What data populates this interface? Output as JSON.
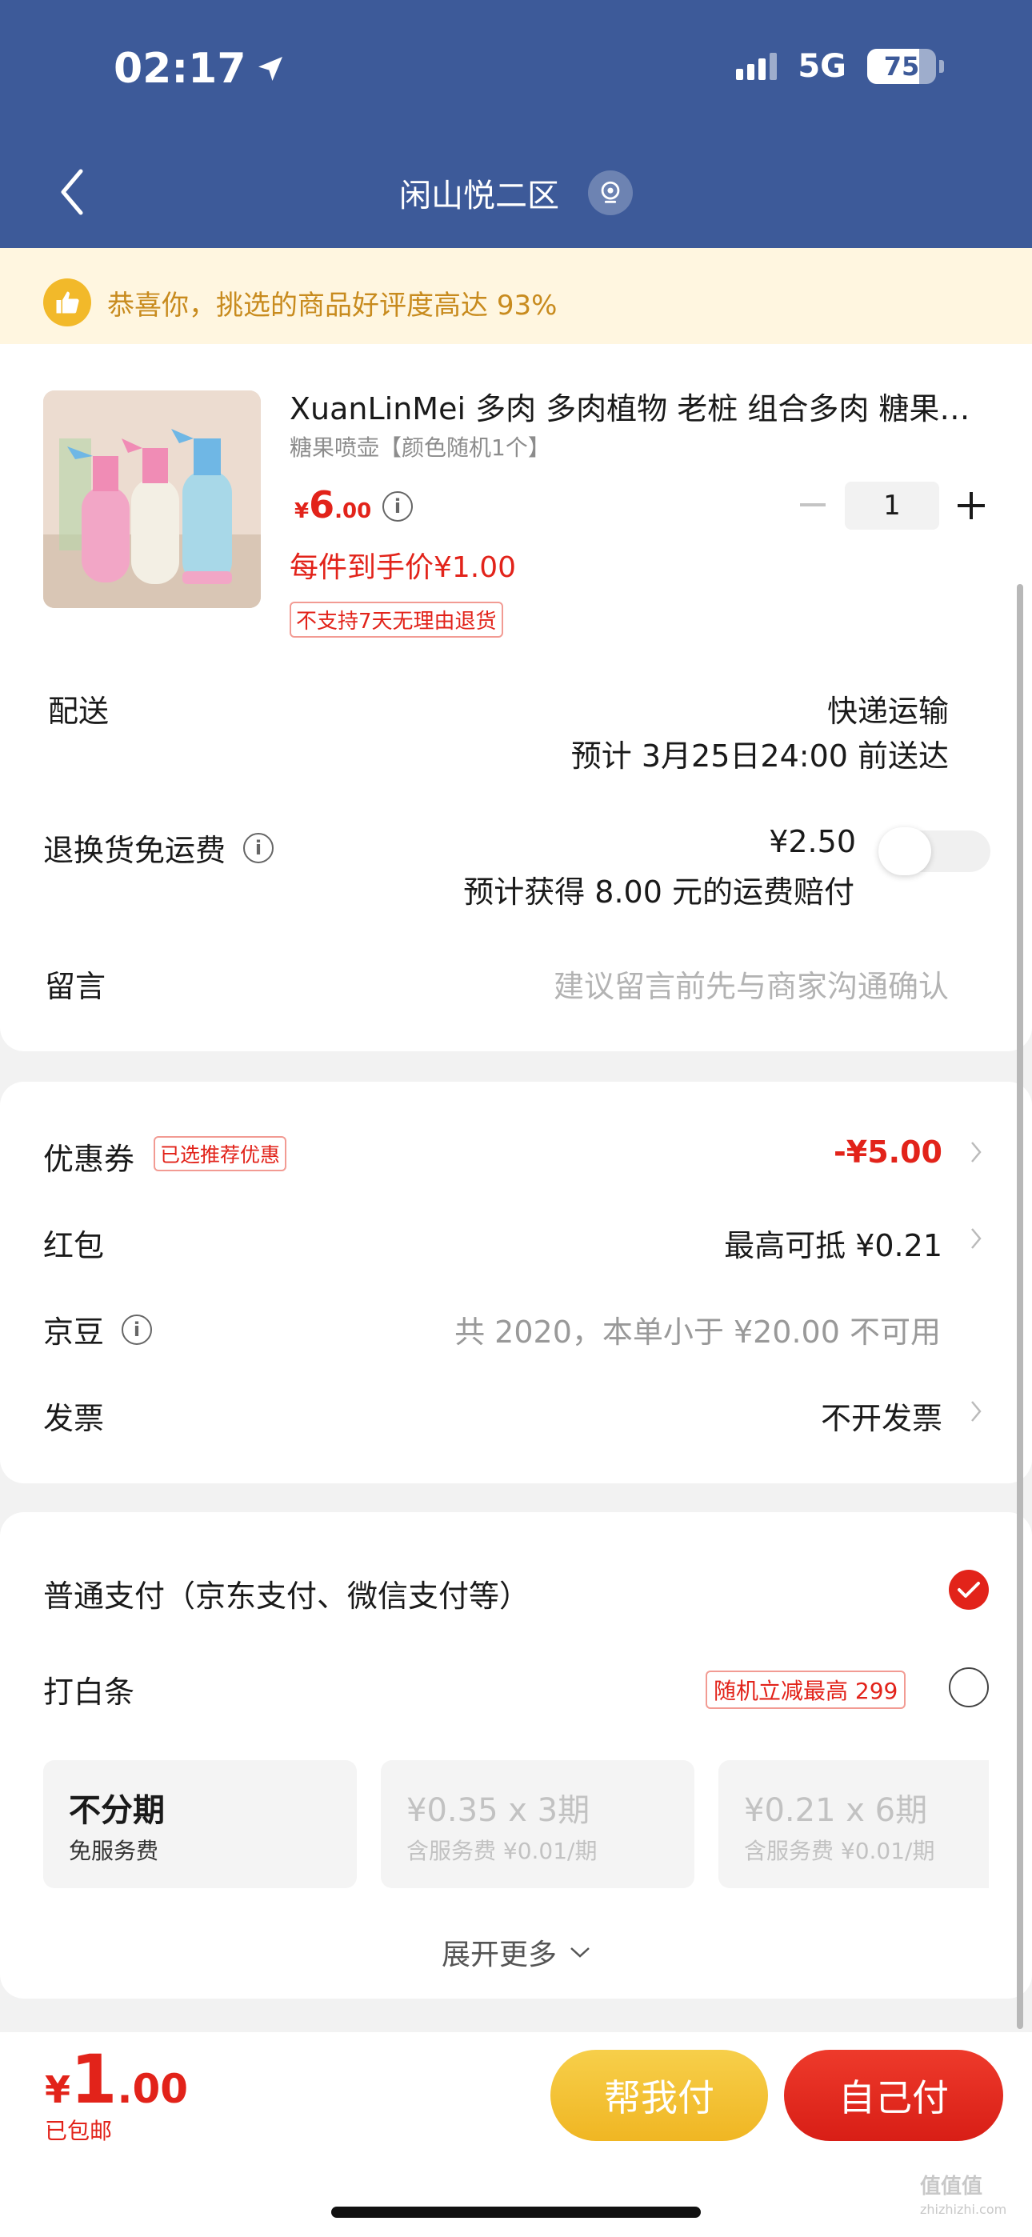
{
  "status_bar": {
    "time": "02:17",
    "network": "5G",
    "battery": "75",
    "battery_level": 0.75
  },
  "nav": {
    "title": "闲山悦二区"
  },
  "banner": {
    "text_prefix": "恭喜你，挑选的商品好评度高达 ",
    "percent": "93%"
  },
  "product": {
    "title": "XuanLinMei 多肉 多肉植物 老桩 组合多肉 糖果…",
    "spec": "糖果喷壶【颜色随机1个】",
    "price_symbol": "¥",
    "price_int": "6",
    "price_dec": ".00",
    "quantity": "1",
    "unit_price_text": "每件到手价¥1.00",
    "return_tag": "不支持7天无理由退货"
  },
  "delivery": {
    "label": "配送",
    "method": "快递运输",
    "eta": "预计 3月25日24:00 前送达"
  },
  "return_shipping": {
    "label": "退换货免运费",
    "price": "¥2.50",
    "note": "预计获得 8.00 元的运费赔付",
    "enabled": false
  },
  "message": {
    "label": "留言",
    "placeholder": "建议留言前先与商家沟通确认"
  },
  "coupon": {
    "label": "优惠券",
    "tag": "已选推荐优惠",
    "value": "-¥5.00"
  },
  "redpacket": {
    "label": "红包",
    "value": "最高可抵 ¥0.21"
  },
  "jingdou": {
    "label": "京豆",
    "value": "共 2020，本单小于 ¥20.00 不可用"
  },
  "invoice": {
    "label": "发票",
    "value": "不开发票"
  },
  "payment": {
    "normal_label": "普通支付（京东支付、微信支付等）",
    "normal_selected": true,
    "baitiao_label": "打白条",
    "baitiao_tag": "随机立减最高 299",
    "baitiao_selected": false,
    "plans": [
      {
        "title": "不分期",
        "sub": "免服务费"
      },
      {
        "title": "¥0.35 x 3期",
        "sub": "含服务费 ¥0.01/期"
      },
      {
        "title": "¥0.21 x 6期",
        "sub": "含服务费 ¥0.01/期"
      }
    ],
    "expand_label": "展开更多"
  },
  "footer": {
    "total_symbol": "¥",
    "total_int": "1",
    "total_dec": ".00",
    "shipping": "已包邮",
    "help_pay": "帮我付",
    "self_pay": "自己付",
    "watermark": "值值值",
    "watermark_url": "zhizhizhi.com"
  },
  "colors": {
    "header": "#3d5a99",
    "accent_red": "#e2231a",
    "help_btn": "#f0b623"
  }
}
